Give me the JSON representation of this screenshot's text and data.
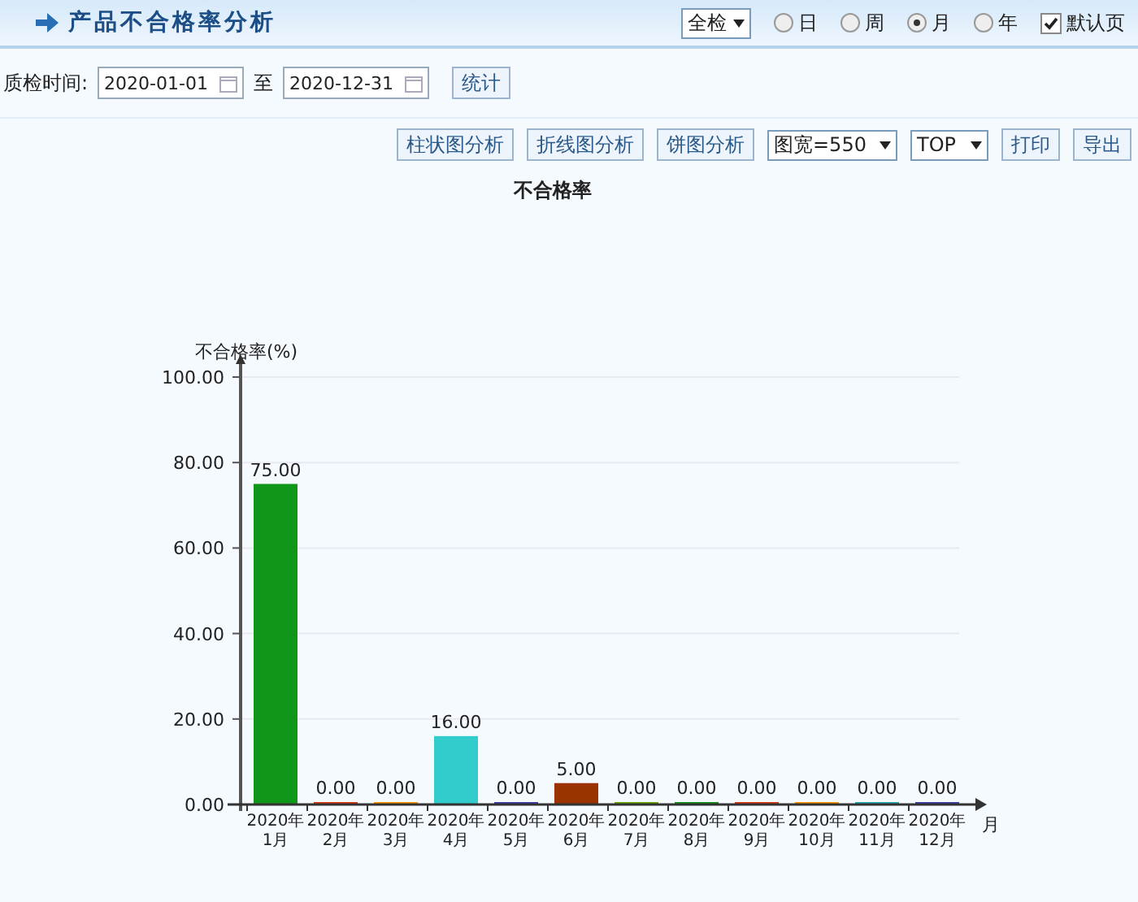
{
  "header": {
    "title": "产品不合格率分析",
    "inspection_select": "全检",
    "periods": [
      {
        "label": "日",
        "selected": false
      },
      {
        "label": "周",
        "selected": false
      },
      {
        "label": "月",
        "selected": true
      },
      {
        "label": "年",
        "selected": false
      }
    ],
    "default_page": {
      "label": "默认页",
      "checked": true
    }
  },
  "filter": {
    "label": "质检时间:",
    "start": "2020-01-01",
    "separator": "至",
    "end": "2020-12-31",
    "button": "统计"
  },
  "toolbar": {
    "buttons": [
      "柱状图分析",
      "折线图分析",
      "饼图分析"
    ],
    "width_select": "图宽=550",
    "top_select": "TOP",
    "actions": [
      "打印",
      "导出"
    ]
  },
  "chart_data": {
    "type": "bar",
    "title": "不合格率",
    "ylabel": "不合格率(%)",
    "xlabel": "月",
    "categories": [
      "2020年 1月",
      "2020年 2月",
      "2020年 3月",
      "2020年 4月",
      "2020年 5月",
      "2020年 6月",
      "2020年 7月",
      "2020年 8月",
      "2020年 9月",
      "2020年 10月",
      "2020年 11月",
      "2020年 12月"
    ],
    "series": [
      {
        "values": [
          75,
          0,
          0,
          16,
          0,
          5,
          0,
          0,
          0,
          0,
          0,
          0
        ],
        "colors": [
          "#109618",
          "#dc3912",
          "#ff9900",
          "#33cccc",
          "#3b3eac",
          "#993300",
          "#66aa00",
          "#109618",
          "#dc3912",
          "#ff9900",
          "#22aaaa",
          "#3b3eac"
        ]
      }
    ],
    "value_labels": [
      "75.00",
      "0.00",
      "0.00",
      "16.00",
      "0.00",
      "5.00",
      "0.00",
      "0.00",
      "0.00",
      "0.00",
      "0.00",
      "0.00"
    ],
    "grid": true,
    "ylim": [
      0,
      100
    ],
    "yticks": [
      {
        "value": 0,
        "label": "0.00"
      },
      {
        "value": 20,
        "label": "20.00"
      },
      {
        "value": 40,
        "label": "40.00"
      },
      {
        "value": 60,
        "label": "60.00"
      },
      {
        "value": 80,
        "label": "80.00"
      },
      {
        "value": 100,
        "label": "100.00"
      }
    ]
  }
}
